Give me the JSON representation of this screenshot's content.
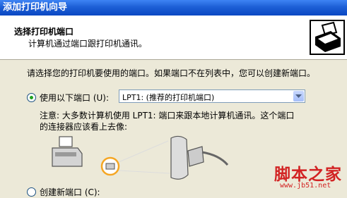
{
  "window": {
    "title": "添加打印机向导"
  },
  "header": {
    "title": "选择打印机端口",
    "subtitle": "计算机通过端口跟打印机通讯。",
    "icon": "printer-icon"
  },
  "body": {
    "instruction": "请选择您的打印机要使用的端口。如果端口不在列表中，您可以创建新端口。",
    "use_port": {
      "label": "使用以下端口 (U):",
      "checked": true
    },
    "port_select": {
      "value": "LPT1: (推荐的打印机端口)"
    },
    "note_line1": "注意: 大多数计算机使用 LPT1: 端口来跟本地计算机通讯。这个端口",
    "note_line2": "的连接器应该看上去像:",
    "create_port": {
      "label": "创建新端口 (C):",
      "checked": false
    }
  },
  "watermark": {
    "text": "脚本之家",
    "url": "www.jb51.net"
  },
  "colors": {
    "titlebar": "#0a47c2",
    "highlight": "#f5a623",
    "watermark": "#d22323"
  }
}
